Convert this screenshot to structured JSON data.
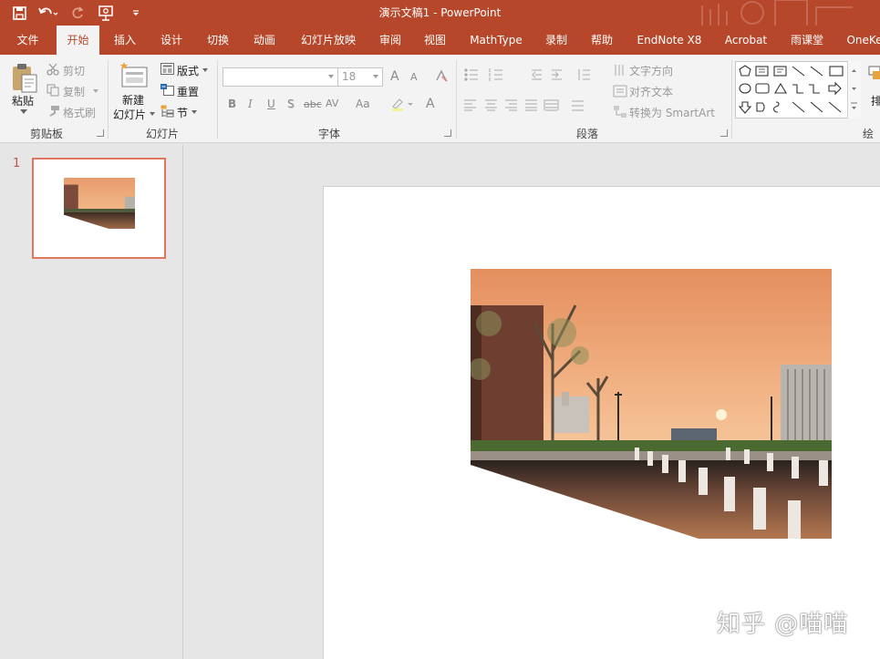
{
  "window": {
    "title": "演示文稿1  -  PowerPoint"
  },
  "tabs": [
    "文件",
    "开始",
    "插入",
    "设计",
    "切换",
    "动画",
    "幻灯片放映",
    "审阅",
    "视图",
    "MathType",
    "录制",
    "帮助",
    "EndNote X8",
    "Acrobat",
    "雨课堂",
    "OneKe"
  ],
  "active_tab": "开始",
  "clipboard": {
    "paste": "粘贴",
    "cut": "剪切",
    "copy": "复制",
    "format_painter": "格式刷",
    "label": "剪贴板"
  },
  "slides_group": {
    "new_slide_line1": "新建",
    "new_slide_line2": "幻灯片",
    "layout": "版式",
    "reset": "重置",
    "section": "节",
    "label": "幻灯片"
  },
  "font": {
    "size": "18",
    "grow": "A",
    "shrink": "A",
    "bold": "B",
    "italic": "I",
    "underline": "U",
    "shadow": "S",
    "strike": "abc",
    "spacing": "AV",
    "case": "Aa",
    "color": "A",
    "label": "字体"
  },
  "paragraph": {
    "text_direction": "文字方向",
    "align_text": "对齐文本",
    "smartart": "转换为 SmartArt",
    "label": "段落"
  },
  "drawing": {
    "label": "绘图",
    "arrange": "排"
  },
  "thumbnails": {
    "slide_number": "1"
  },
  "watermark": "知乎 @喵喵",
  "colors": {
    "accent": "#b7472a",
    "thumb_border": "#e0765b"
  }
}
